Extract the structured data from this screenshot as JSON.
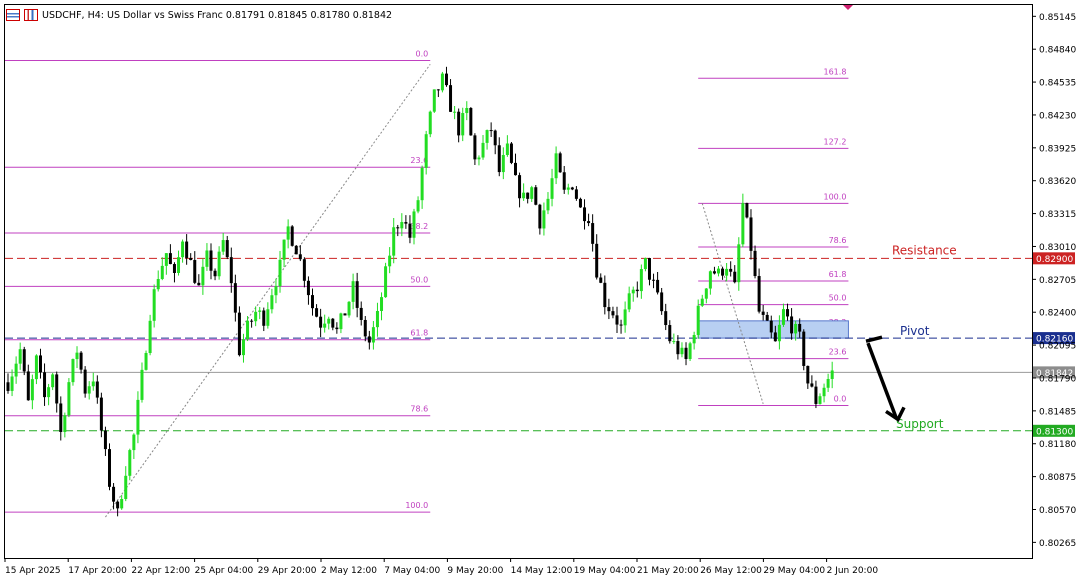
{
  "header": {
    "symbol_line": "USDCHF, H4:  US Dollar vs Swiss Franc  0.81791 0.81845 0.81780 0.81842",
    "icons": [
      "chart-list-icon",
      "chart-bars-icon"
    ]
  },
  "colors": {
    "bull": "#22dd22",
    "bear": "#000000",
    "fib": "#c040c0",
    "resistance": "#cc2222",
    "pivot": "#1a2f8f",
    "support": "#22aa22",
    "pivot_zone": "#b8cff2"
  },
  "chart_data": {
    "type": "candlestick",
    "symbol": "USDCHF",
    "timeframe": "H4",
    "ylim": [
      0.8012,
      0.8525
    ],
    "y_ticks": [
      "0.85145",
      "0.84840",
      "0.84535",
      "0.84230",
      "0.83925",
      "0.83620",
      "0.83315",
      "0.83010",
      "0.82705",
      "0.82400",
      "0.82095",
      "0.81790",
      "0.81485",
      "0.81180",
      "0.80875",
      "0.80570",
      "0.80265"
    ],
    "x_ticks": [
      "15 Apr 2025",
      "17 Apr 20:00",
      "22 Apr 12:00",
      "25 Apr 04:00",
      "29 Apr 20:00",
      "2 May 12:00",
      "7 May 04:00",
      "9 May 20:00",
      "14 May 12:00",
      "19 May 04:00",
      "21 May 20:00",
      "26 May 12:00",
      "29 May 04:00",
      "2 Jun 20:00"
    ],
    "close_path": [
      [
        0,
        0.8175
      ],
      [
        3,
        0.8205
      ],
      [
        5,
        0.8155
      ],
      [
        7,
        0.8195
      ],
      [
        9,
        0.816
      ],
      [
        11,
        0.8185
      ],
      [
        13,
        0.8128
      ],
      [
        15,
        0.8175
      ],
      [
        17,
        0.8205
      ],
      [
        19,
        0.8168
      ],
      [
        21,
        0.818
      ],
      [
        23,
        0.813
      ],
      [
        25,
        0.8082
      ],
      [
        27,
        0.8052
      ],
      [
        29,
        0.8095
      ],
      [
        31,
        0.8125
      ],
      [
        33,
        0.818
      ],
      [
        35,
        0.824
      ],
      [
        37,
        0.8275
      ],
      [
        39,
        0.8295
      ],
      [
        41,
        0.827
      ],
      [
        43,
        0.831
      ],
      [
        45,
        0.8285
      ],
      [
        47,
        0.8262
      ],
      [
        49,
        0.829
      ],
      [
        51,
        0.8275
      ],
      [
        53,
        0.8305
      ],
      [
        55,
        0.827
      ],
      [
        57,
        0.8205
      ],
      [
        59,
        0.8225
      ],
      [
        61,
        0.824
      ],
      [
        63,
        0.8235
      ],
      [
        65,
        0.826
      ],
      [
        67,
        0.8282
      ],
      [
        69,
        0.8318
      ],
      [
        71,
        0.83
      ],
      [
        73,
        0.8275
      ],
      [
        75,
        0.8245
      ],
      [
        77,
        0.823
      ],
      [
        79,
        0.824
      ],
      [
        81,
        0.8222
      ],
      [
        83,
        0.824
      ],
      [
        85,
        0.8262
      ],
      [
        87,
        0.8228
      ],
      [
        89,
        0.8212
      ],
      [
        91,
        0.8235
      ],
      [
        93,
        0.8275
      ],
      [
        95,
        0.8315
      ],
      [
        97,
        0.833
      ],
      [
        99,
        0.831
      ],
      [
        101,
        0.8345
      ],
      [
        103,
        0.84
      ],
      [
        105,
        0.844
      ],
      [
        107,
        0.8455
      ],
      [
        109,
        0.8432
      ],
      [
        111,
        0.841
      ],
      [
        113,
        0.8425
      ],
      [
        115,
        0.838
      ],
      [
        117,
        0.8395
      ],
      [
        119,
        0.841
      ],
      [
        121,
        0.837
      ],
      [
        123,
        0.839
      ],
      [
        125,
        0.836
      ],
      [
        127,
        0.8345
      ],
      [
        129,
        0.8355
      ],
      [
        131,
        0.8325
      ],
      [
        133,
        0.8345
      ],
      [
        135,
        0.838
      ],
      [
        137,
        0.835
      ],
      [
        139,
        0.836
      ],
      [
        141,
        0.8335
      ],
      [
        143,
        0.833
      ],
      [
        145,
        0.828
      ],
      [
        147,
        0.825
      ],
      [
        149,
        0.824
      ],
      [
        151,
        0.8225
      ],
      [
        153,
        0.825
      ],
      [
        155,
        0.8265
      ],
      [
        157,
        0.8285
      ],
      [
        159,
        0.8265
      ],
      [
        161,
        0.824
      ],
      [
        163,
        0.8215
      ],
      [
        165,
        0.8205
      ],
      [
        167,
        0.8195
      ],
      [
        169,
        0.8225
      ],
      [
        171,
        0.8255
      ],
      [
        173,
        0.828
      ],
      [
        175,
        0.8275
      ],
      [
        177,
        0.8285
      ],
      [
        179,
        0.8262
      ],
      [
        181,
        0.834
      ],
      [
        183,
        0.83
      ],
      [
        185,
        0.824
      ],
      [
        187,
        0.8225
      ],
      [
        189,
        0.821
      ],
      [
        191,
        0.824
      ],
      [
        193,
        0.8228
      ],
      [
        195,
        0.8215
      ],
      [
        197,
        0.8175
      ],
      [
        199,
        0.8158
      ],
      [
        201,
        0.8172
      ],
      [
        203,
        0.8184
      ]
    ],
    "x_max": 207,
    "fib_retracements": [
      {
        "x0": 0,
        "x1": 104,
        "levels": [
          {
            "label": "0.0",
            "price": 0.84735
          },
          {
            "label": "23.6",
            "price": 0.83745
          },
          {
            "label": "38.2",
            "price": 0.83135
          },
          {
            "label": "50.0",
            "price": 0.8264
          },
          {
            "label": "61.8",
            "price": 0.82145
          },
          {
            "label": "78.6",
            "price": 0.8144
          },
          {
            "label": "100.0",
            "price": 0.80545
          }
        ]
      },
      {
        "x0": 170,
        "x1": 207,
        "levels": [
          {
            "label": "161.8",
            "price": 0.8457
          },
          {
            "label": "127.2",
            "price": 0.8392
          },
          {
            "label": "100.0",
            "price": 0.8341
          },
          {
            "label": "78.6",
            "price": 0.83005
          },
          {
            "label": "61.8",
            "price": 0.8269
          },
          {
            "label": "50.0",
            "price": 0.8247
          },
          {
            "label": "38.2",
            "price": 0.82245
          },
          {
            "label": "23.6",
            "price": 0.8197
          },
          {
            "label": "0.0",
            "price": 0.81535
          }
        ]
      }
    ],
    "horizontal_levels": [
      {
        "name": "Resistance",
        "price": 0.829,
        "price_label": "0.82900",
        "color": "#cc2222"
      },
      {
        "name": "Pivot",
        "price": 0.8216,
        "price_label": "0.82160",
        "color": "#1a2f8f"
      },
      {
        "name": "Support",
        "price": 0.813,
        "price_label": "0.81300",
        "color": "#22aa22"
      }
    ],
    "current_price": {
      "price": 0.81842,
      "label": "0.81842"
    },
    "pivot_zone": {
      "x0": 170,
      "x1": 207,
      "price_low": 0.8216,
      "price_high": 0.8232
    },
    "trend_lines": [
      {
        "from": [
          24,
          0.805
        ],
        "to": [
          104,
          0.847
        ]
      },
      {
        "from": [
          171,
          0.8341
        ],
        "to": [
          186,
          0.8155
        ]
      }
    ],
    "arrow": {
      "from": [
        195,
        0.8215
      ],
      "to": [
        201,
        0.8148
      ]
    }
  }
}
